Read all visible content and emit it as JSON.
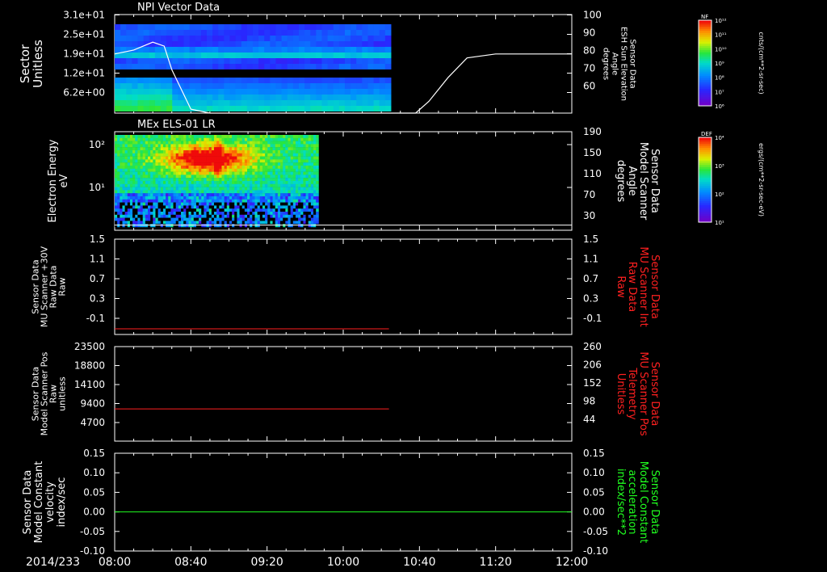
{
  "date_label": "2014/233",
  "x_ticks": [
    "08:00",
    "08:40",
    "09:20",
    "10:00",
    "10:40",
    "11:20",
    "12:00"
  ],
  "panels": [
    {
      "title": "NPI Vector Data",
      "left_label": "Sector\nUnitless",
      "left_ticks": [
        "3.1e+01",
        "2.5e+01",
        "1.9e+01",
        "1.2e+01",
        "6.2e+00"
      ],
      "right_ticks": [
        "100",
        "90",
        "80",
        "70",
        "60"
      ],
      "right_label": "Sensor Data\nESH Sun Elevation\nAngle\ndegrees",
      "right_color": "#ffffff",
      "colorbar": {
        "title": "NF",
        "unit": "cnts/(cm**2-sr-sec)",
        "ticks": [
          "10¹²",
          "10¹¹",
          "10¹⁰",
          "10⁹",
          "10⁸",
          "10⁷",
          "10⁶"
        ]
      }
    },
    {
      "title": "MEx ELS-01 LR",
      "left_label": "Electron Energy\neV",
      "left_ticks": [
        "10²",
        "10¹"
      ],
      "right_ticks": [
        "190",
        "150",
        "110",
        "70",
        "30"
      ],
      "right_label": "Sensor Data\nModel Scanner\nAngle\ndegrees",
      "right_color": "#ffffff",
      "colorbar": {
        "title": "DEF",
        "unit": "ergs/(cm**2-sr-sec-eV)",
        "ticks": [
          "10⁴",
          "10³",
          "10²",
          "10¹"
        ]
      }
    },
    {
      "title": "",
      "left_label": "Sensor Data\nMU Scanner +30V\nRaw Data\nRaw",
      "left_ticks": [
        "1.5",
        "1.1",
        "0.7",
        "0.3",
        "-0.1"
      ],
      "right_ticks": [
        "1.5",
        "1.1",
        "0.7",
        "0.3",
        "-0.1"
      ],
      "right_label": "Sensor Data\nMU Scanner Int\nRaw Data\nRaw",
      "right_color": "#ff2020"
    },
    {
      "title": "",
      "left_label": "Sensor Data\nModel Scanner Pos\nRaw\nunitless",
      "left_ticks": [
        "23500",
        "18800",
        "14100",
        "9400",
        "4700"
      ],
      "right_ticks": [
        "260",
        "206",
        "152",
        "98",
        "44"
      ],
      "right_label": "Sensor Data\nMU Scanner Pos\nTelemetry\nUnitless",
      "right_color": "#ff2020"
    },
    {
      "title": "",
      "left_label": "Sensor Data\nModel Constant\nvelocity\nindex/sec",
      "left_ticks": [
        "0.15",
        "0.10",
        "0.05",
        "0.00",
        "-0.05",
        "-0.10"
      ],
      "right_ticks": [
        "0.15",
        "0.10",
        "0.05",
        "0.00",
        "-0.05",
        "-0.10"
      ],
      "right_label": "Sensor Data\nModel Constant\nacceleration\nindex/sec**2",
      "right_color": "#20ff20"
    }
  ],
  "chart_data": [
    {
      "type": "heatmap",
      "title": "NPI Vector Data",
      "x_range": [
        "08:00",
        "12:00"
      ],
      "data_end": "10:25",
      "overlay_series": {
        "name": "ESH Sun Elevation Angle",
        "x_minutes_after_0800": [
          0,
          10,
          20,
          26,
          30,
          40,
          50,
          60,
          150,
          158,
          165,
          175,
          185,
          200,
          240
        ],
        "y": [
          80,
          82,
          86,
          84,
          72,
          52,
          50,
          50,
          50,
          50,
          56,
          68,
          78,
          80,
          80
        ],
        "y_range": [
          50,
          100
        ]
      }
    },
    {
      "type": "heatmap",
      "title": "MEx ELS-01 LR",
      "x_range": [
        "08:00",
        "12:00"
      ],
      "data_end": "09:47",
      "overlay_series": {
        "name": "Model Scanner Angle",
        "x_minutes_after_0800": [
          0,
          240
        ],
        "y": [
          10,
          10
        ],
        "y_range": [
          0,
          190
        ]
      }
    },
    {
      "type": "line",
      "series": [
        {
          "name": "MU Scanner +30V Raw Data",
          "x_minutes_after_0800": [
            0,
            144
          ],
          "y": [
            -0.1,
            -0.1
          ],
          "color": "#ff2020"
        }
      ],
      "ylim": [
        -0.2,
        1.5
      ]
    },
    {
      "type": "line",
      "series": [
        {
          "name": "Model Scanner Pos",
          "x_minutes_after_0800": [
            0,
            144
          ],
          "y": [
            8000,
            8000
          ],
          "color": "#ff2020"
        }
      ],
      "ylim": [
        0,
        23500
      ]
    },
    {
      "type": "line",
      "series": [
        {
          "name": "Model Constant velocity",
          "x_minutes_after_0800": [
            0,
            240
          ],
          "y": [
            0.0,
            0.0
          ],
          "color": "#20ff20"
        }
      ],
      "ylim": [
        -0.1,
        0.15
      ]
    }
  ]
}
